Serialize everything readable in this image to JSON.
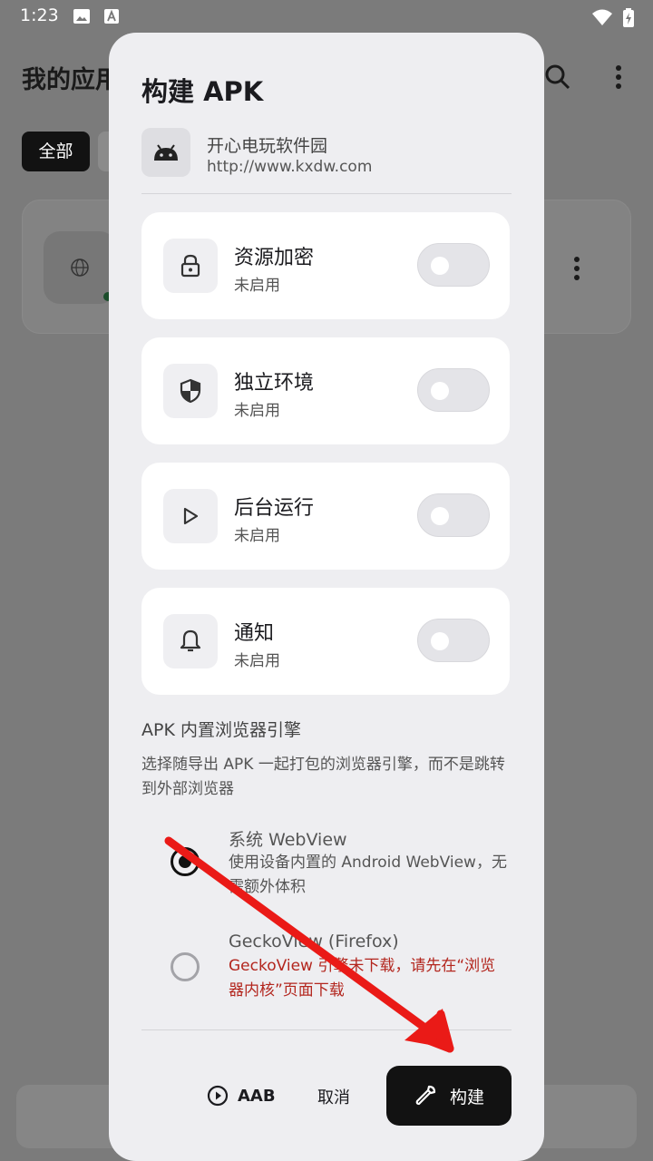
{
  "status_bar": {
    "time": "1:23"
  },
  "background": {
    "title": "我的应用",
    "chip_all": "全部"
  },
  "dialog": {
    "title": "构建 APK",
    "app": {
      "name": "开心电玩软件园",
      "url": "http://www.kxdw.com",
      "icon": "android-icon"
    },
    "options": [
      {
        "title": "资源加密",
        "status": "未启用",
        "icon": "lock-icon",
        "enabled": false
      },
      {
        "title": "独立环境",
        "status": "未启用",
        "icon": "shield-icon",
        "enabled": false
      },
      {
        "title": "后台运行",
        "status": "未启用",
        "icon": "play-icon",
        "enabled": false
      },
      {
        "title": "通知",
        "status": "未启用",
        "icon": "bell-icon",
        "enabled": false
      }
    ],
    "engine_section": {
      "title": "APK 内置浏览器引擎",
      "description": "选择随导出 APK 一起打包的浏览器引擎，而不是跳转到外部浏览器",
      "choices": [
        {
          "title": "系统 WebView",
          "description": "使用设备内置的 Android WebView，无需额外体积",
          "selected": true
        },
        {
          "title": "GeckoView (Firefox)",
          "description": "GeckoView 引擎未下载，请先在“浏览器内核”页面下载",
          "selected": false
        }
      ]
    },
    "actions": {
      "aab": "AAB",
      "cancel": "取消",
      "build": "构建"
    }
  },
  "colors": {
    "primary": "#121212",
    "error": "#b3261e",
    "surface": "#eeeef1",
    "annotation_arrow": "#ea1a17"
  }
}
